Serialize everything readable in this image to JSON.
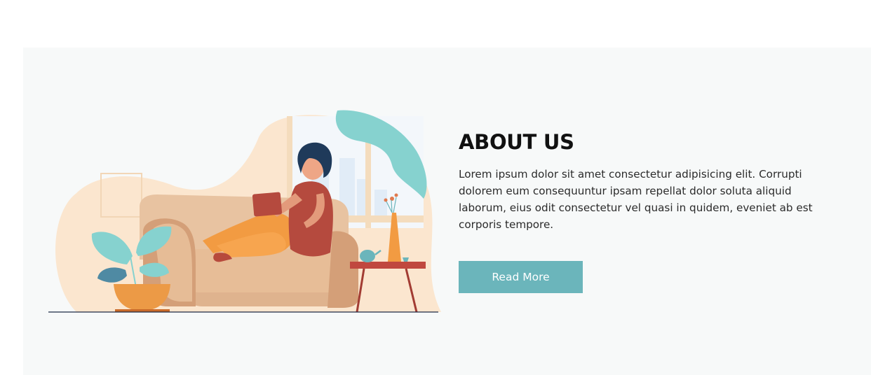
{
  "about": {
    "heading": "ABOUT US",
    "body": "Lorem ipsum dolor sit amet consectetur adipisicing elit. Corrupti dolorem eum consequuntur ipsam repellat dolor soluta aliquid laborum, eius odit consectetur vel quasi in quidem, eveniet ab est corporis tempore.",
    "button_label": "Read More"
  },
  "colors": {
    "section_background": "#f7f9f9",
    "button_background": "#6bb5bb",
    "button_text": "#ffffff",
    "heading": "#111111"
  },
  "illustration": {
    "subject": "woman-reading-tablet-on-sofa-illustration"
  }
}
